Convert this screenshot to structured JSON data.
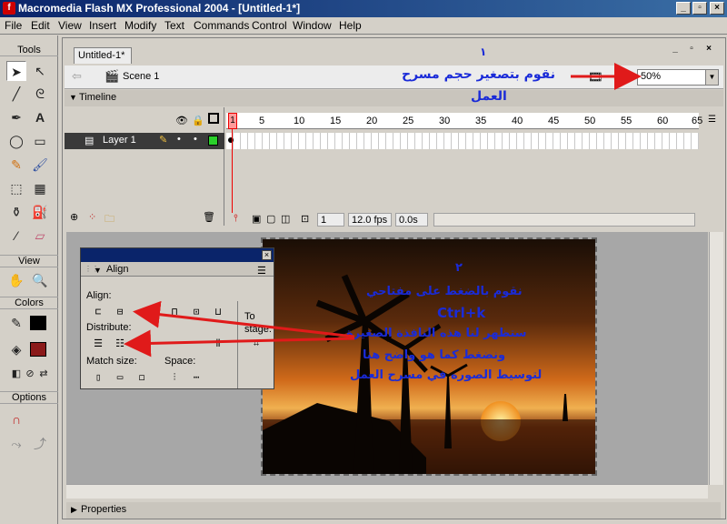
{
  "window": {
    "title": "Macromedia Flash MX Professional 2004 - [Untitled-1*]",
    "app_icon": "flash-icon"
  },
  "menu": [
    "File",
    "Edit",
    "View",
    "Insert",
    "Modify",
    "Text",
    "Commands",
    "Control",
    "Window",
    "Help"
  ],
  "tools": {
    "header": "Tools",
    "view_header": "View",
    "colors_header": "Colors",
    "options_header": "Options",
    "stroke_color": "#000000",
    "fill_color": "#8b1a1a"
  },
  "document": {
    "tab_label": "Untitled-1*",
    "scene_label": "Scene 1",
    "zoom_value": "50%",
    "timeline_label": "Timeline",
    "layer_name": "Layer 1",
    "frame_numbers": [
      "1",
      "5",
      "10",
      "15",
      "20",
      "25",
      "30",
      "35",
      "40",
      "45",
      "50",
      "55",
      "60",
      "65"
    ],
    "current_frame": "1",
    "frame_rate": "12.0 fps",
    "elapsed_time": "0.0s",
    "properties_label": "Properties"
  },
  "align_panel": {
    "title": "Align",
    "align_label": "Align:",
    "distribute_label": "Distribute:",
    "match_size_label": "Match size:",
    "space_label": "Space:",
    "to_stage_label": "To stage:"
  },
  "annotations": {
    "step1_number": "١",
    "step1_text": "نقوم بتصغير حجم مسرح",
    "step1_text2": "العمل",
    "step2_number": "٢",
    "step2_line1": "نقوم بالضغط على مفتاحي",
    "step2_line2": "Ctrl+k",
    "step2_line3": "ستظهر لنا هذه النافذة الصغيرة",
    "step2_line4": "ونضغط كما هو واضح هنا",
    "step2_line5": "لتوسيط الصوره في مسرح العمل",
    "color": "#1a2bd8",
    "arrow_color": "#e01a1a"
  }
}
